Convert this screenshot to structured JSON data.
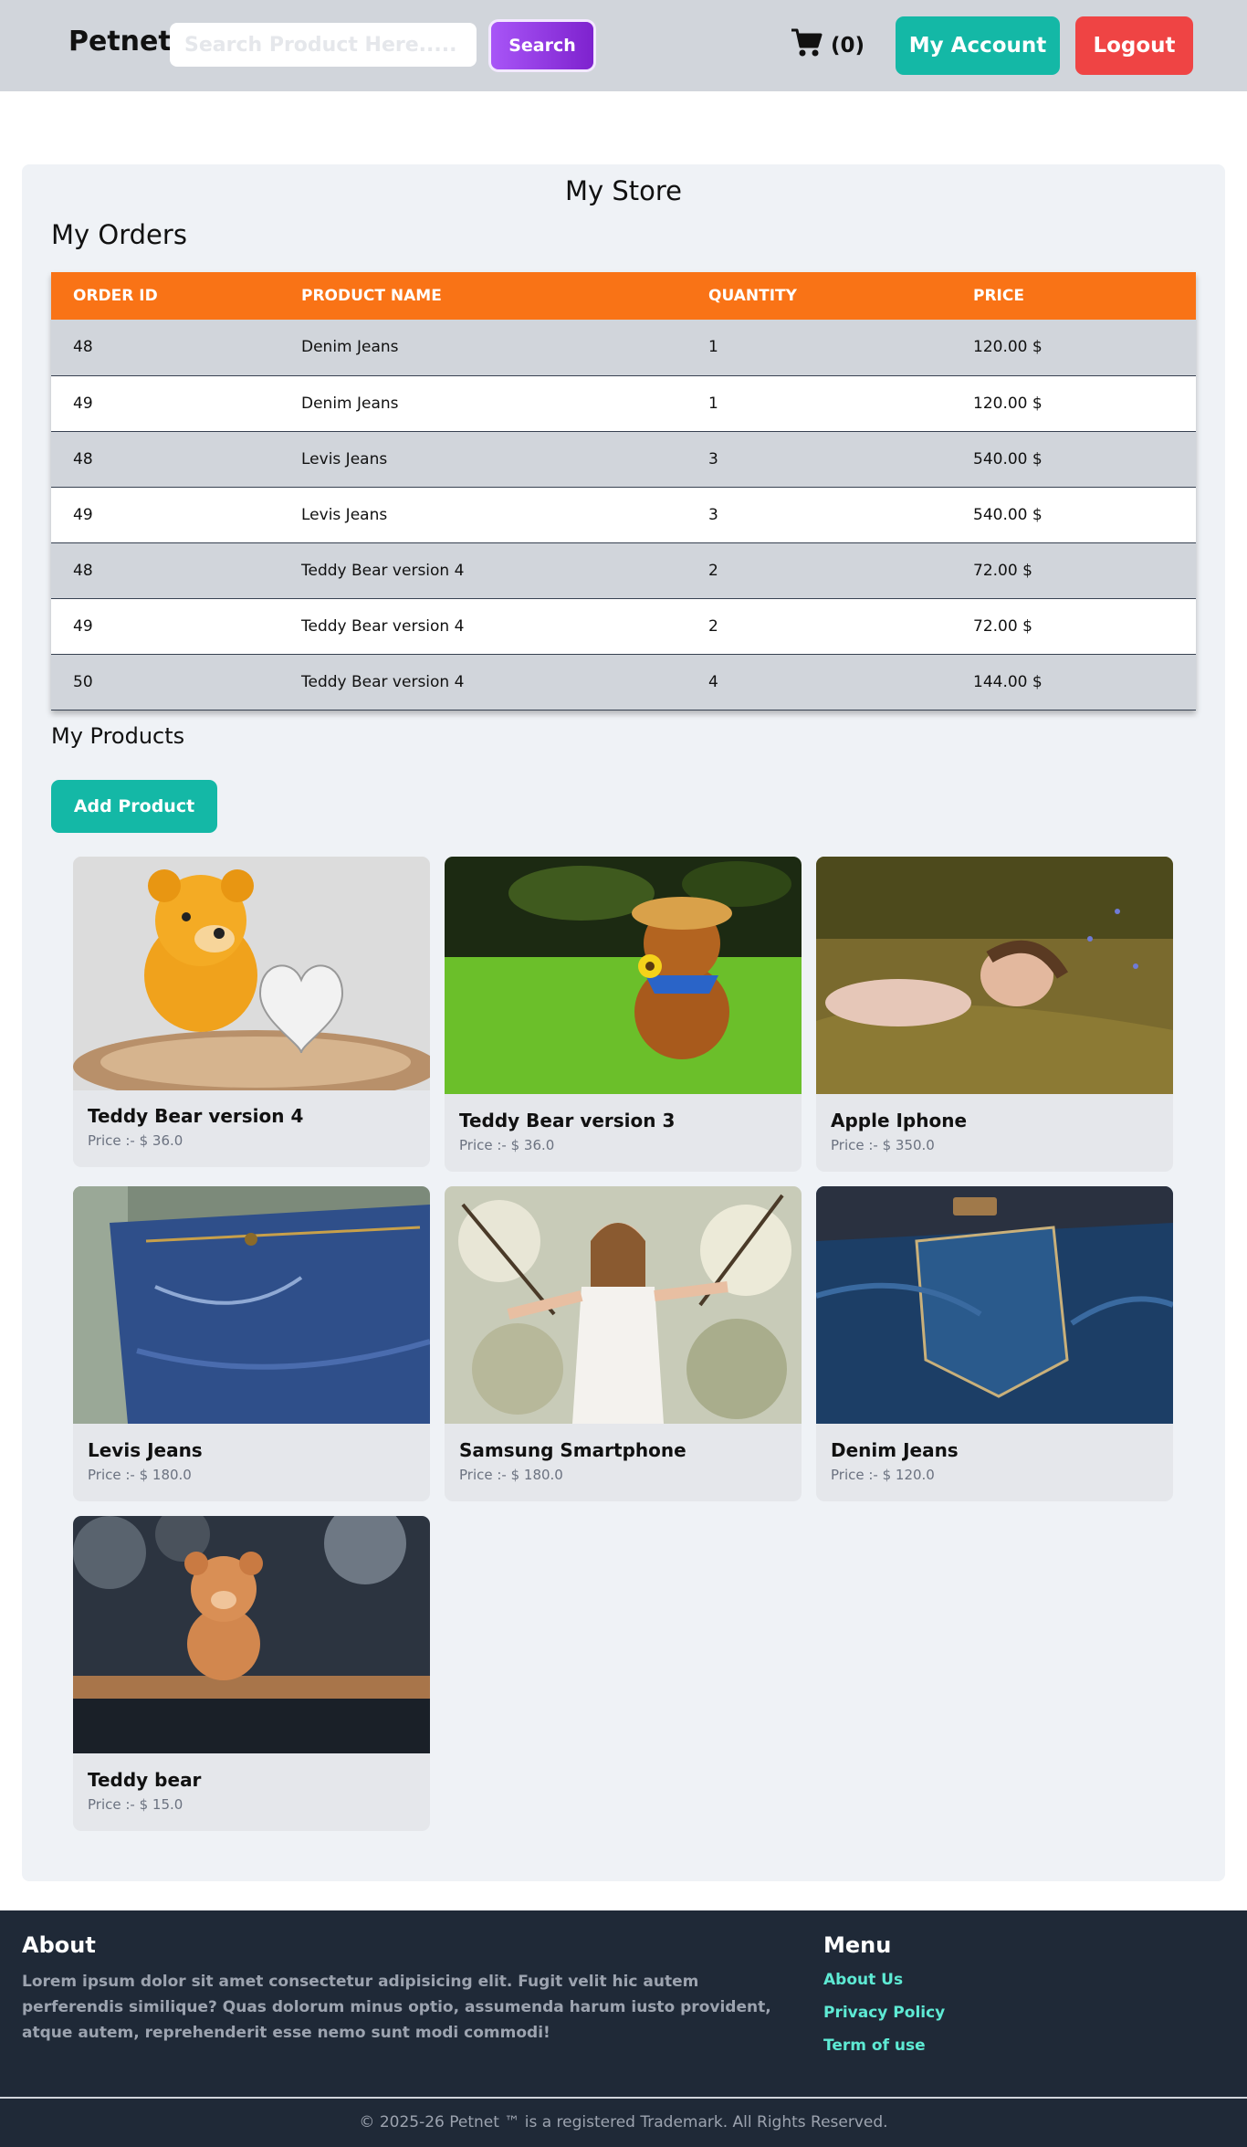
{
  "header": {
    "brand": "Petnet",
    "search_placeholder": "Search Product Here.....",
    "search_label": "Search",
    "cart_count": "(0)",
    "account_label": "My Account",
    "logout_label": "Logout"
  },
  "store": {
    "title": "My Store",
    "orders_title": "My Orders",
    "products_title": "My Products",
    "add_product_label": "Add Product"
  },
  "orders": {
    "columns": [
      "ORDER ID",
      "PRODUCT NAME",
      "QUANTITY",
      "PRICE"
    ],
    "rows": [
      [
        "48",
        "Denim Jeans",
        "1",
        "120.00 $"
      ],
      [
        "49",
        "Denim Jeans",
        "1",
        "120.00 $"
      ],
      [
        "48",
        "Levis Jeans",
        "3",
        "540.00 $"
      ],
      [
        "49",
        "Levis Jeans",
        "3",
        "540.00 $"
      ],
      [
        "48",
        "Teddy Bear version 4",
        "2",
        "72.00 $"
      ],
      [
        "49",
        "Teddy Bear version 4",
        "2",
        "72.00 $"
      ],
      [
        "50",
        "Teddy Bear version 4",
        "4",
        "144.00 $"
      ]
    ]
  },
  "products": [
    {
      "name": "Teddy Bear version 4",
      "price": "Price :- $ 36.0",
      "image": "teddy-bear-heart-photo"
    },
    {
      "name": "Teddy Bear version 3",
      "price": "Price :- $ 36.0",
      "image": "teddy-bear-grass-photo"
    },
    {
      "name": "Apple Iphone",
      "price": "Price :- $ 350.0",
      "image": "woman-grass-photo"
    },
    {
      "name": "Levis Jeans",
      "price": "Price :- $ 180.0",
      "image": "jeans-closeup-photo"
    },
    {
      "name": "Samsung Smartphone",
      "price": "Price :- $ 180.0",
      "image": "woman-blossoms-photo"
    },
    {
      "name": "Denim Jeans",
      "price": "Price :- $ 120.0",
      "image": "jeans-pocket-photo"
    },
    {
      "name": "Teddy bear",
      "price": "Price :- $ 15.0",
      "image": "teddy-bear-shelf-photo"
    }
  ],
  "footer": {
    "about_title": "About",
    "about_text": "Lorem ipsum dolor sit amet consectetur adipisicing elit. Fugit velit hic autem perferendis similique? Quas dolorum minus optio, assumenda harum iusto provident, atque autem, reprehenderit esse nemo sunt modi commodi!",
    "menu_title": "Menu",
    "menu_links": [
      "About Us",
      "Privacy Policy",
      "Term of use"
    ],
    "copyright": "© 2025-26  Petnet ™ is a registered Trademark. All Rights Reserved."
  },
  "colors": {
    "header_bg": "#d1d5db",
    "table_header": "#f97316",
    "teal_button": "#14b8a6",
    "logout_button": "#ef4444",
    "search_button": "#9333ea",
    "footer_bg": "#1f2937",
    "footer_link": "#5eead4"
  }
}
